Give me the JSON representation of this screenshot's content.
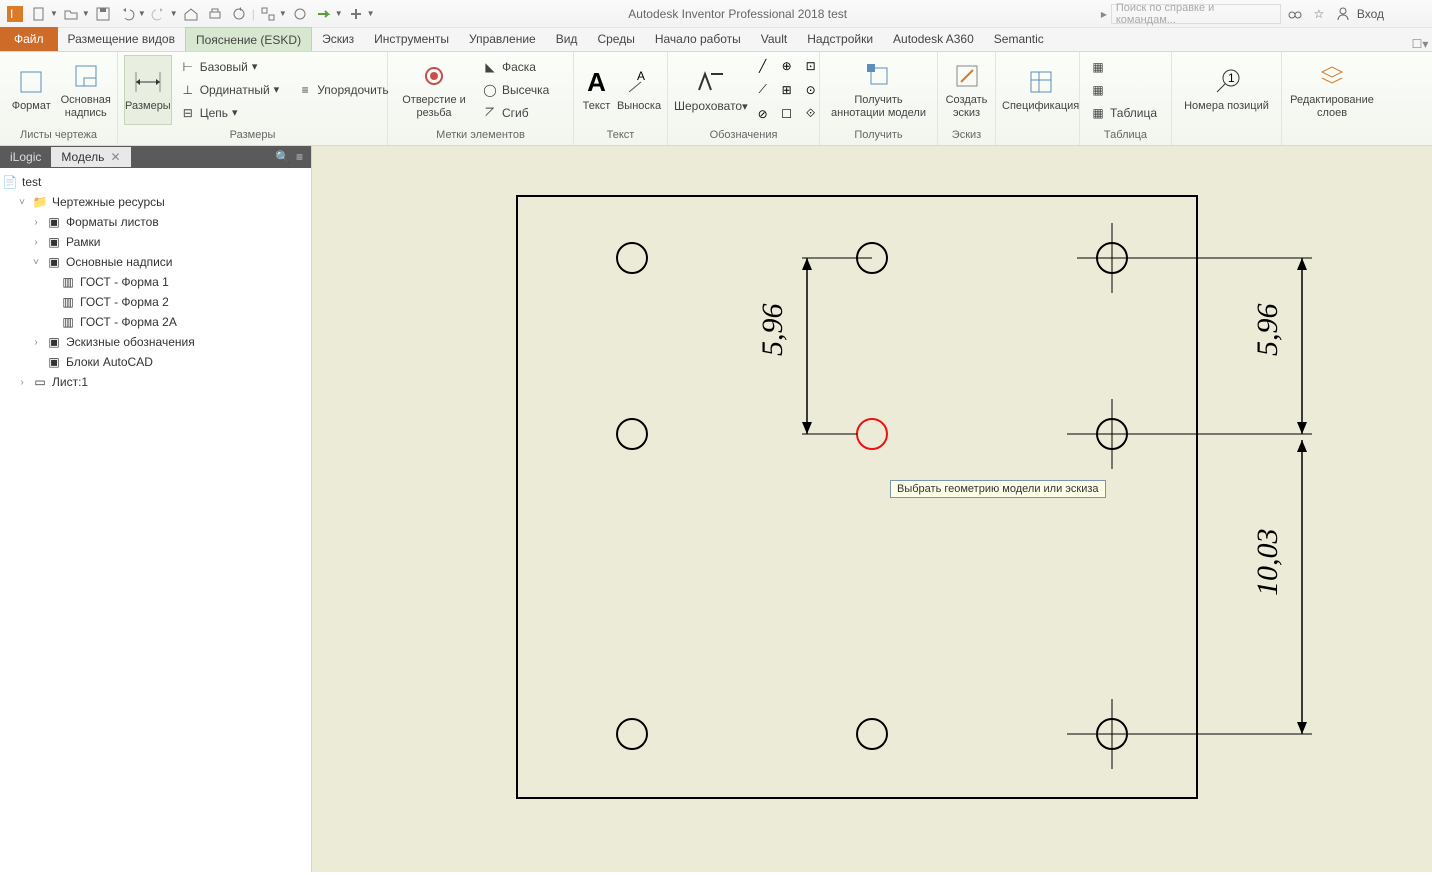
{
  "app": {
    "title": "Autodesk Inventor Professional 2018   test"
  },
  "search": {
    "placeholder": "Поиск по справке и командам..."
  },
  "signin": "Вход",
  "tabs": {
    "file": "Файл",
    "items": [
      "Размещение видов",
      "Пояснение (ESKD)",
      "Эскиз",
      "Инструменты",
      "Управление",
      "Вид",
      "Среды",
      "Начало работы",
      "Vault",
      "Надстройки",
      "Autodesk A360",
      "Semantic"
    ],
    "active_index": 1
  },
  "ribbon": {
    "groups": {
      "sheets": {
        "label": "Листы чертежа",
        "format": "Формат",
        "base": "Основная надпись"
      },
      "dims": {
        "label": "Размеры",
        "dim": "Размеры",
        "base": "Базовый",
        "ord": "Ординатный",
        "chain": "Цепь",
        "arrange": "Упорядочить"
      },
      "marks": {
        "label": "Метки элементов",
        "hole": "Отверстие и резьба",
        "chamfer": "Фаска",
        "cut": "Высечка",
        "bend": "Сгиб"
      },
      "text": {
        "label": "Текст",
        "text": "Текст",
        "leader": "Выноска"
      },
      "annot": {
        "label": "Обозначения",
        "rough": "Шероховато"
      },
      "get": {
        "label": "Получить",
        "getann": "Получить аннотации модели"
      },
      "sketch": {
        "label": "Эскиз",
        "create": "Создать эскиз"
      },
      "spec": {
        "label": "",
        "spec": "Спецификация"
      },
      "table": {
        "label": "Таблица",
        "table": "Таблица"
      },
      "pos": {
        "label": "",
        "pos": "Номера позиций"
      },
      "layers": {
        "label": "",
        "layers": "Редактирование слоев"
      }
    }
  },
  "panel": {
    "tabs": {
      "ilogic": "iLogic",
      "model": "Модель"
    }
  },
  "tree": {
    "root": "test",
    "res": "Чертежные ресурсы",
    "formats": "Форматы листов",
    "frames": "Рамки",
    "titleblocks": "Основные надписи",
    "tb1": "ГОСТ - Форма 1",
    "tb2": "ГОСТ - Форма 2",
    "tb2a": "ГОСТ - Форма 2А",
    "sketchsym": "Эскизные обозначения",
    "acad": "Блоки AutoCAD",
    "sheet": "Лист:1"
  },
  "drawing": {
    "dim1": "5,96",
    "dim2": "5,96",
    "dim3": "10,03",
    "tooltip": "Выбрать геометрию модели или эскиза"
  }
}
